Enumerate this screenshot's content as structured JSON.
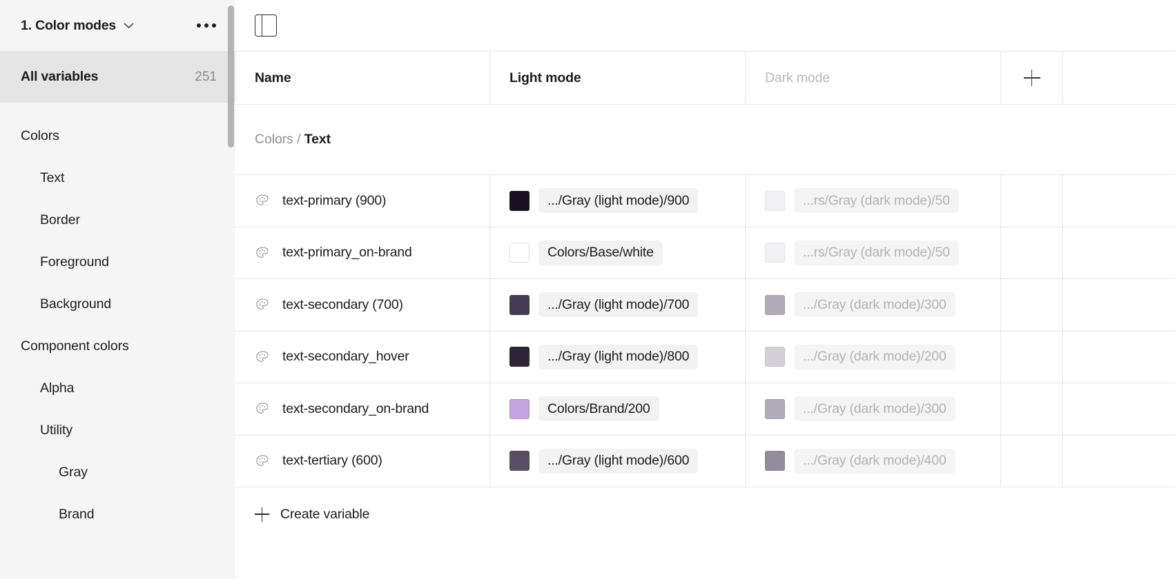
{
  "sidebar": {
    "collection_title": "1. Color modes",
    "chevron_icon": "chevron-down-icon",
    "more_icon": "more-horizontal-icon",
    "all_variables": {
      "label": "All variables",
      "count": "251"
    },
    "groups": [
      {
        "label": "Colors",
        "depth": 0
      },
      {
        "label": "Text",
        "depth": 1
      },
      {
        "label": "Border",
        "depth": 1
      },
      {
        "label": "Foreground",
        "depth": 1
      },
      {
        "label": "Background",
        "depth": 1
      },
      {
        "label": "Component colors",
        "depth": 0
      },
      {
        "label": "Alpha",
        "depth": 1
      },
      {
        "label": "Utility",
        "depth": 1
      },
      {
        "label": "Gray",
        "depth": 2
      },
      {
        "label": "Brand",
        "depth": 2
      }
    ]
  },
  "toolbar": {
    "panel_toggle_icon": "sidebar-toggle-icon"
  },
  "table": {
    "columns": {
      "name": "Name",
      "light_mode": "Light mode",
      "dark_mode": "Dark mode",
      "add_mode_icon": "plus-icon"
    },
    "breadcrumb": {
      "parent": "Colors",
      "separator": "/",
      "leaf": "Text"
    },
    "rows": [
      {
        "icon": "palette-icon",
        "name": "text-primary (900)",
        "light": {
          "swatch": "#1a1024",
          "value": ".../Gray (light mode)/900"
        },
        "dark": {
          "swatch": "#f1f1f3",
          "value": "...rs/Gray (dark mode)/50"
        }
      },
      {
        "icon": "palette-icon",
        "name": "text-primary_on-brand",
        "light": {
          "swatch": "#ffffff",
          "value": "Colors/Base/white"
        },
        "dark": {
          "swatch": "#f1f1f3",
          "value": "...rs/Gray (dark mode)/50"
        }
      },
      {
        "icon": "palette-icon",
        "name": "text-secondary (700)",
        "light": {
          "swatch": "#443c52",
          "value": ".../Gray (light mode)/700"
        },
        "dark": {
          "swatch": "#b0abb8",
          "value": ".../Gray (dark mode)/300"
        }
      },
      {
        "icon": "palette-icon",
        "name": "text-secondary_hover",
        "light": {
          "swatch": "#2e2438",
          "value": ".../Gray (light mode)/800"
        },
        "dark": {
          "swatch": "#d2cfd8",
          "value": ".../Gray (dark mode)/200"
        }
      },
      {
        "icon": "palette-icon",
        "name": "text-secondary_on-brand",
        "light": {
          "swatch": "#c5a3df",
          "value": "Colors/Brand/200"
        },
        "dark": {
          "swatch": "#b0abb8",
          "value": ".../Gray (dark mode)/300"
        }
      },
      {
        "icon": "palette-icon",
        "name": "text-tertiary (600)",
        "light": {
          "swatch": "#574f63",
          "value": ".../Gray (light mode)/600"
        },
        "dark": {
          "swatch": "#918c9c",
          "value": ".../Gray (dark mode)/400"
        }
      }
    ],
    "create_variable": {
      "icon": "plus-icon",
      "label": "Create variable"
    }
  },
  "colors": {
    "sidebar_bg": "#f5f5f5",
    "selected_row_bg": "#e4e4e4",
    "border": "#e6e6e6",
    "text_primary": "#1c1c1c",
    "text_muted": "#8e8e8e",
    "pill_bg": "#f2f2f2"
  }
}
